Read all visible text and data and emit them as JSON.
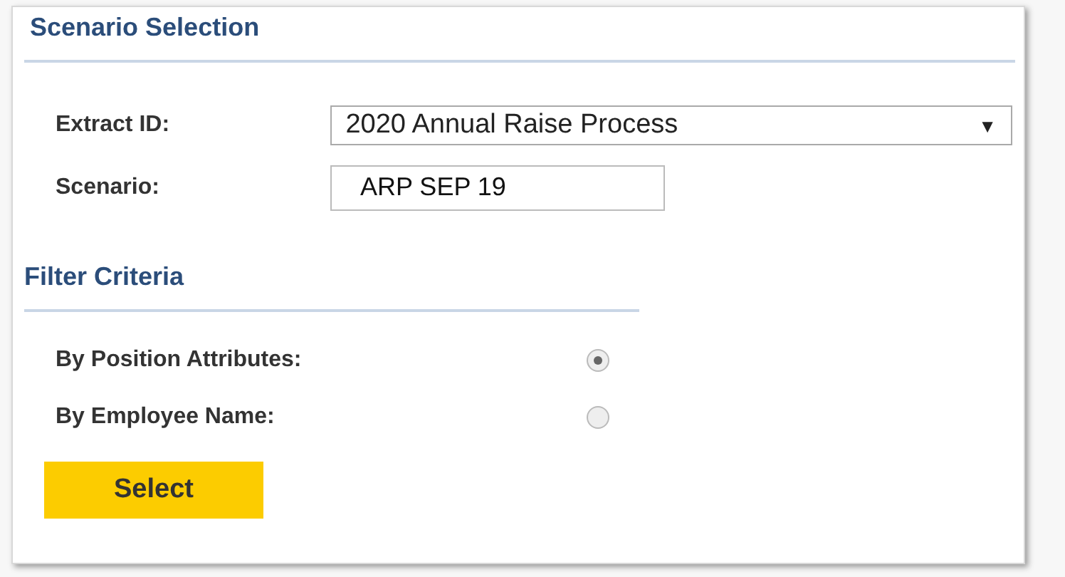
{
  "scenario_section": {
    "title": "Scenario Selection"
  },
  "extract_id": {
    "label": "Extract ID:",
    "value": "2020  Annual Raise Process",
    "arrow": "▼"
  },
  "scenario": {
    "label": "Scenario:",
    "value": "ARP SEP 19"
  },
  "filter_section": {
    "title": "Filter Criteria"
  },
  "filters": [
    {
      "label": "By Position Attributes:",
      "selected": true
    },
    {
      "label": "By Employee Name:",
      "selected": false
    }
  ],
  "button": {
    "label": "Select"
  }
}
